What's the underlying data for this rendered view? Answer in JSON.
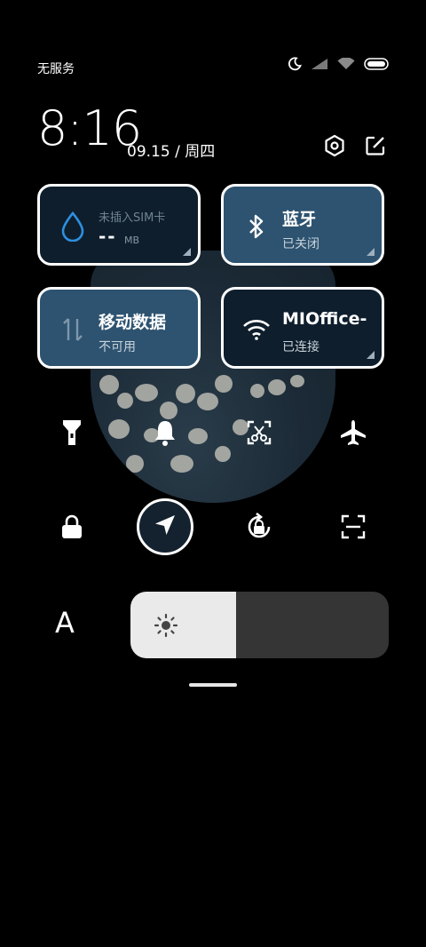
{
  "status_bar": {
    "carrier": "无服务",
    "icons": [
      "moon-icon",
      "signal-icon",
      "wifi-icon",
      "battery-icon"
    ]
  },
  "header": {
    "time": "8:16",
    "date": "09.15 / 周四",
    "actions": [
      "settings-icon",
      "edit-icon"
    ]
  },
  "tiles": {
    "sim": {
      "label": "未插入SIM卡",
      "value": "--",
      "unit": "MB",
      "icon": "water-drop-icon"
    },
    "bluetooth": {
      "title": "蓝牙",
      "status": "已关闭",
      "icon": "bluetooth-icon"
    },
    "mobile_data": {
      "title": "移动数据",
      "status": "不可用",
      "icon": "data-arrows-icon"
    },
    "wifi": {
      "title": "MIOffice-",
      "status": "已连接",
      "icon": "wifi-icon"
    }
  },
  "toggles_row1": [
    "flashlight-icon",
    "bell-icon",
    "screenshot-icon",
    "airplane-icon"
  ],
  "toggles_row2": [
    "lock-icon",
    "location-icon",
    "rotation-lock-icon",
    "scan-icon"
  ],
  "brightness": {
    "auto_label": "A",
    "level": 0.41
  },
  "colors": {
    "tile_dark": "#0e1e2c",
    "tile_lit": "#2d5370",
    "accent_blue": "#2f8fe0"
  }
}
